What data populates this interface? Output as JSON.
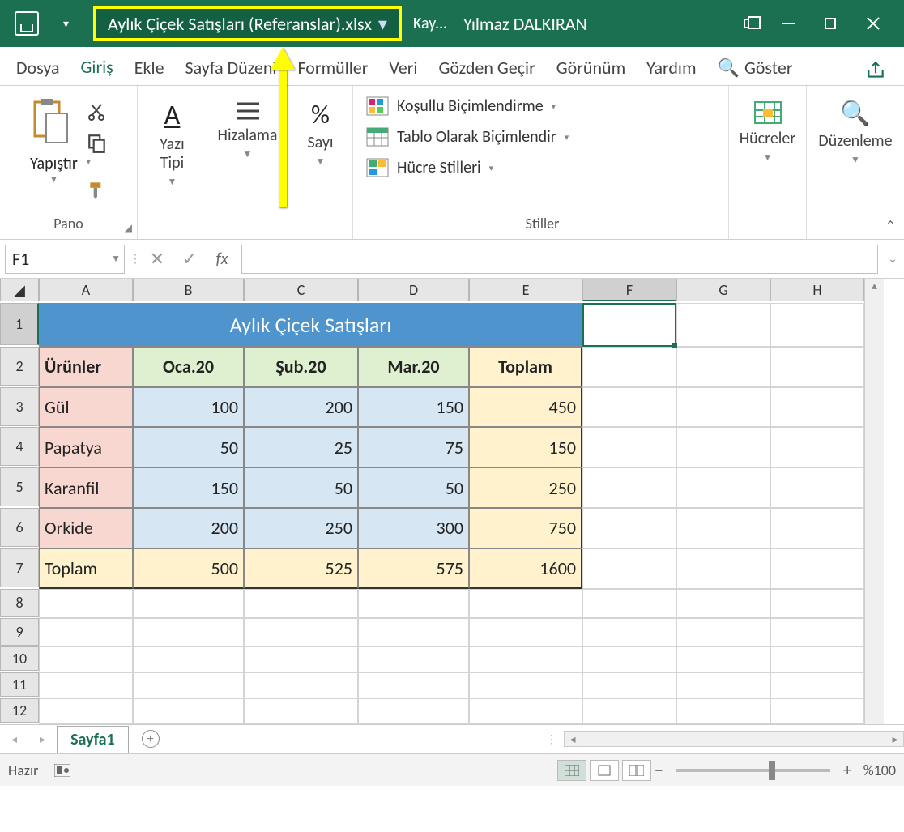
{
  "titlebar": {
    "filename": "Aylık Çiçek Satışları (Referanslar).xlsx",
    "autosave": "Kay...",
    "user": "Yılmaz DALKIRAN"
  },
  "menu": {
    "tabs": [
      "Dosya",
      "Giriş",
      "Ekle",
      "Sayfa Düzeni",
      "Formüller",
      "Veri",
      "Gözden Geçir",
      "Görünüm",
      "Yardım"
    ],
    "search_label": "Göster"
  },
  "ribbon": {
    "pano": {
      "paste": "Yapıştır",
      "label": "Pano"
    },
    "font": {
      "btn": "Yazı Tipi"
    },
    "align": {
      "btn": "Hizalama"
    },
    "number": {
      "btn": "Sayı"
    },
    "styles": {
      "cond": "Koşullu Biçimlendirme",
      "table": "Tablo Olarak Biçimlendir",
      "cell": "Hücre Stilleri",
      "label": "Stiller"
    },
    "cells": {
      "btn": "Hücreler"
    },
    "editing": {
      "btn": "Düzenleme"
    }
  },
  "formula": {
    "namebox": "F1",
    "value": ""
  },
  "grid": {
    "cols": [
      "A",
      "B",
      "C",
      "D",
      "E",
      "F",
      "G",
      "H"
    ],
    "title": "Aylık Çiçek Satışları",
    "headers": {
      "products": "Ürünler",
      "m1": "Oca.20",
      "m2": "Şub.20",
      "m3": "Mar.20",
      "total": "Toplam"
    },
    "rows": [
      {
        "name": "Gül",
        "m1": "100",
        "m2": "200",
        "m3": "150",
        "total": "450"
      },
      {
        "name": "Papatya",
        "m1": "50",
        "m2": "25",
        "m3": "75",
        "total": "150"
      },
      {
        "name": "Karanfil",
        "m1": "150",
        "m2": "50",
        "m3": "50",
        "total": "250"
      },
      {
        "name": "Orkide",
        "m1": "200",
        "m2": "250",
        "m3": "300",
        "total": "750"
      }
    ],
    "totals": {
      "label": "Toplam",
      "m1": "500",
      "m2": "525",
      "m3": "575",
      "total": "1600"
    }
  },
  "sheet": {
    "name": "Sayfa1"
  },
  "status": {
    "ready": "Hazır",
    "zoom": "%100"
  },
  "chart_data": {
    "type": "table",
    "title": "Aylık Çiçek Satışları",
    "categories": [
      "Oca.20",
      "Şub.20",
      "Mar.20",
      "Toplam"
    ],
    "series": [
      {
        "name": "Gül",
        "values": [
          100,
          200,
          150,
          450
        ]
      },
      {
        "name": "Papatya",
        "values": [
          50,
          25,
          75,
          150
        ]
      },
      {
        "name": "Karanfil",
        "values": [
          150,
          50,
          50,
          250
        ]
      },
      {
        "name": "Orkide",
        "values": [
          200,
          250,
          300,
          750
        ]
      },
      {
        "name": "Toplam",
        "values": [
          500,
          525,
          575,
          1600
        ]
      }
    ]
  }
}
